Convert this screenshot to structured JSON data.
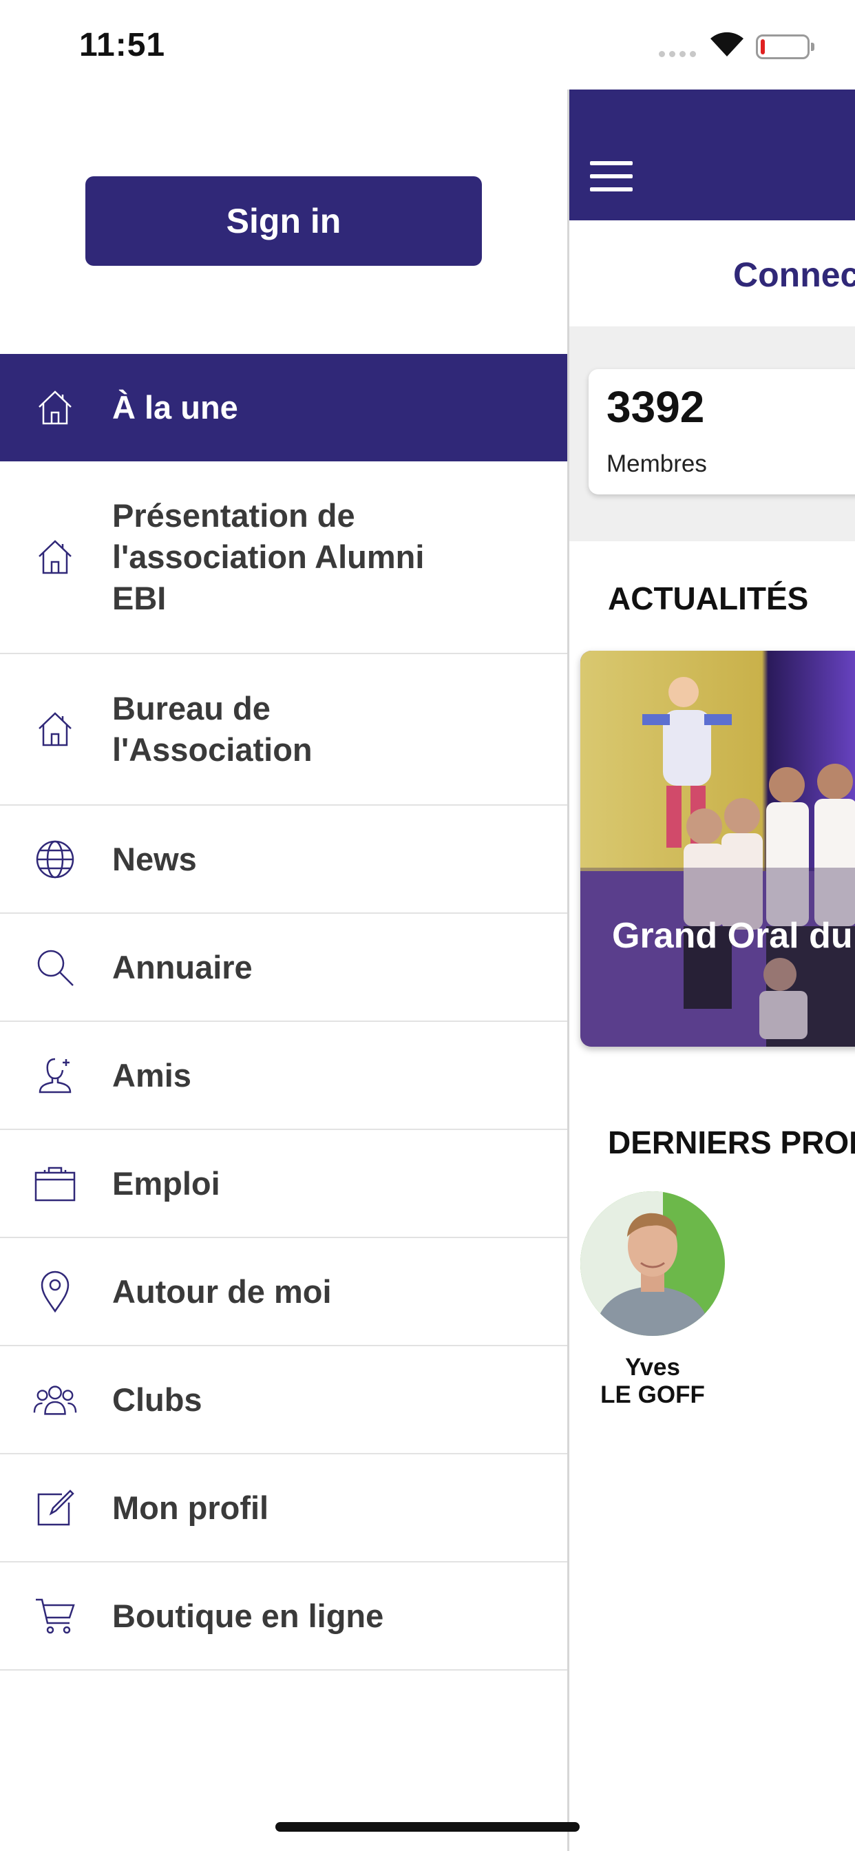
{
  "status_bar": {
    "time": "11:51"
  },
  "drawer": {
    "signin_label": "Sign in",
    "menu": [
      {
        "label": "À la une",
        "icon": "home-icon",
        "active": true
      },
      {
        "label": "Présentation de l'association Alumni EBI",
        "icon": "home-icon"
      },
      {
        "label": "Bureau de l'Association",
        "icon": "home-icon"
      },
      {
        "label": "News",
        "icon": "globe-icon"
      },
      {
        "label": "Annuaire",
        "icon": "search-icon"
      },
      {
        "label": "Amis",
        "icon": "add-friend-icon"
      },
      {
        "label": "Emploi",
        "icon": "briefcase-icon"
      },
      {
        "label": "Autour de moi",
        "icon": "location-pin-icon"
      },
      {
        "label": "Clubs",
        "icon": "group-icon"
      },
      {
        "label": "Mon profil",
        "icon": "edit-icon"
      },
      {
        "label": "Boutique en ligne",
        "icon": "cart-icon"
      }
    ]
  },
  "main": {
    "connect_label": "Connect",
    "stats": {
      "value": "3392",
      "label": "Membres"
    },
    "news_title": "ACTUALITÉS",
    "news_card_title": "Grand Oral du",
    "profiles_title": "DERNIERS PROFILS",
    "profile": {
      "first_name": "Yves",
      "last_name": "LE GOFF"
    }
  },
  "colors": {
    "primary": "#302878",
    "text": "#3a3a3a",
    "divider": "#e2e2e2"
  }
}
